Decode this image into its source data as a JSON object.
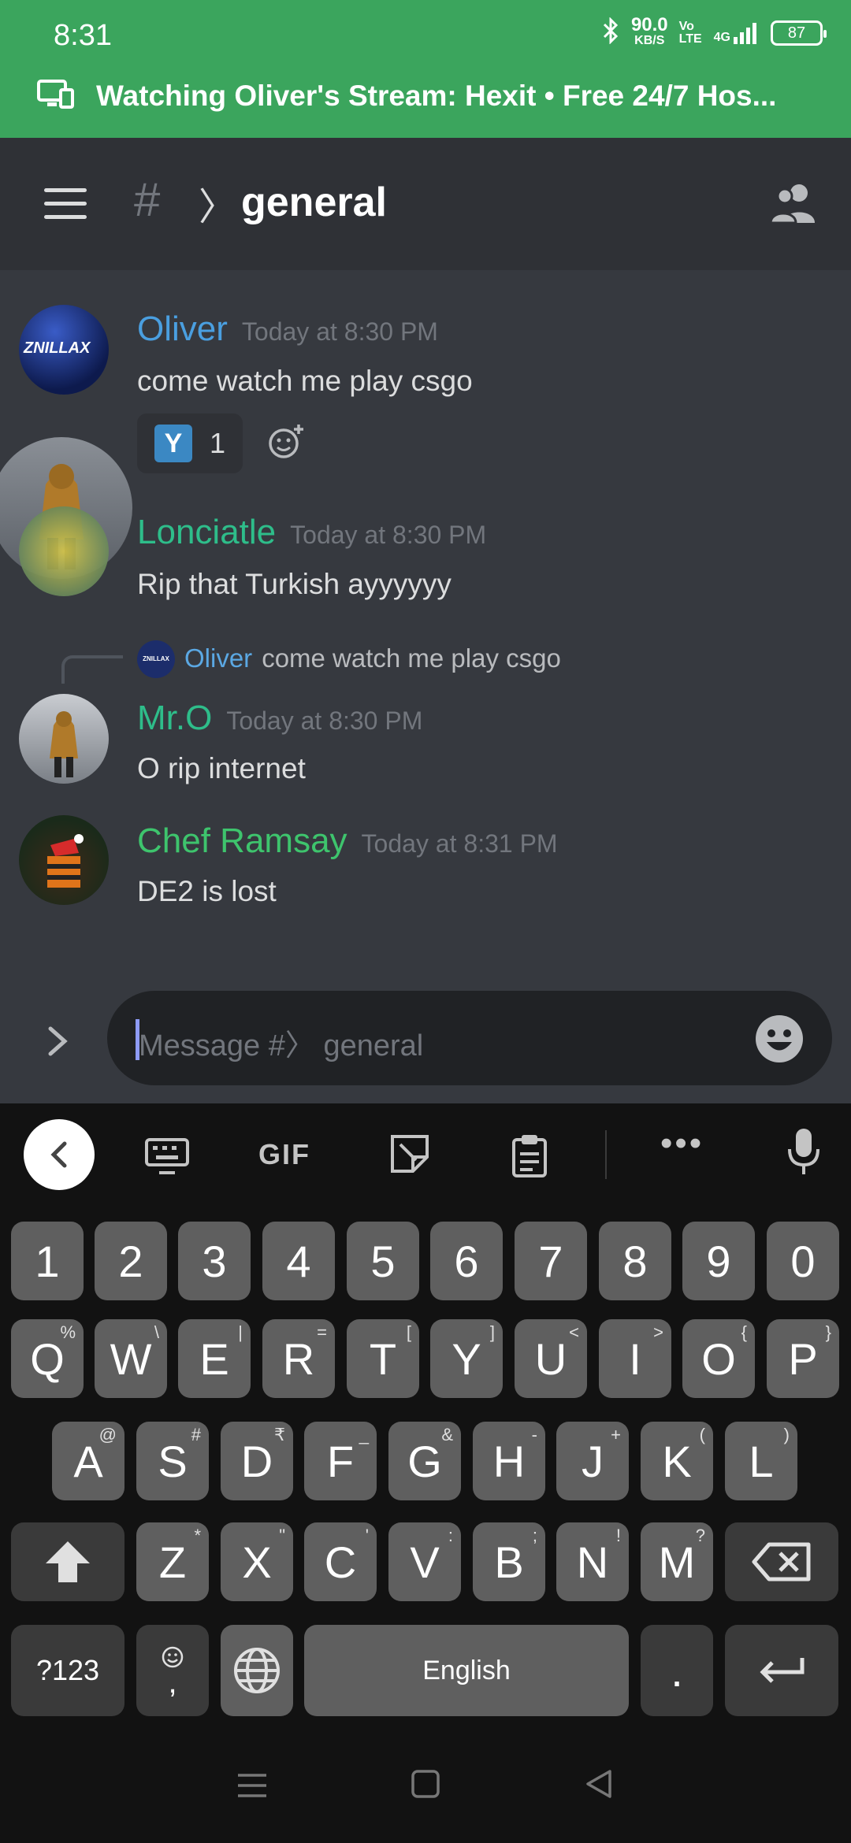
{
  "status_bar": {
    "time": "8:31",
    "speed_value": "90.0",
    "speed_unit": "KB/S",
    "volte": "Vo LTE",
    "network": "4G",
    "battery": "87"
  },
  "stream_banner": {
    "text": "Watching Oliver's Stream: Hexit • Free 24/7 Hos..."
  },
  "header": {
    "hash": "#",
    "chevron": "〉",
    "channel": "general"
  },
  "messages": [
    {
      "author": "Oliver",
      "author_color": "#4a9fe0",
      "time": "Today at 8:30 PM",
      "text": "come watch me play csgo",
      "avatar_label": "ZNILLAX"
    },
    {
      "author": "Lonciatle",
      "author_color": "#2ebd8a",
      "time": "Today at 8:30 PM",
      "text": "Rip that Turkish ayyyyyy"
    },
    {
      "author": "Mr.O",
      "author_color": "#2ebd8a",
      "time": "Today at 8:30 PM",
      "text": "O rip internet"
    },
    {
      "author": "Chef Ramsay",
      "author_color": "#3ec46d",
      "time": "Today at 8:31 PM",
      "text": "DE2 is lost"
    }
  ],
  "reaction": {
    "emoji": "Y",
    "count": "1"
  },
  "reply": {
    "avatar_label": "ZNILLAX",
    "author": "Oliver",
    "text": "come watch me play csgo"
  },
  "composer": {
    "placeholder": "Message #〉 general"
  },
  "keyboard": {
    "toolbar": {
      "gif": "GIF",
      "more": "•••"
    },
    "numbers": [
      "1",
      "2",
      "3",
      "4",
      "5",
      "6",
      "7",
      "8",
      "9",
      "0"
    ],
    "row1": [
      {
        "k": "Q",
        "h": "%"
      },
      {
        "k": "W",
        "h": "\\"
      },
      {
        "k": "E",
        "h": "|"
      },
      {
        "k": "R",
        "h": "="
      },
      {
        "k": "T",
        "h": "["
      },
      {
        "k": "Y",
        "h": "]"
      },
      {
        "k": "U",
        "h": "<"
      },
      {
        "k": "I",
        "h": ">"
      },
      {
        "k": "O",
        "h": "{"
      },
      {
        "k": "P",
        "h": "}"
      }
    ],
    "row2": [
      {
        "k": "A",
        "h": "@"
      },
      {
        "k": "S",
        "h": "#"
      },
      {
        "k": "D",
        "h": "₹"
      },
      {
        "k": "F",
        "h": "_"
      },
      {
        "k": "G",
        "h": "&"
      },
      {
        "k": "H",
        "h": "-"
      },
      {
        "k": "J",
        "h": "+"
      },
      {
        "k": "K",
        "h": "("
      },
      {
        "k": "L",
        "h": ")"
      }
    ],
    "row3": [
      {
        "k": "Z",
        "h": "*"
      },
      {
        "k": "X",
        "h": "\""
      },
      {
        "k": "C",
        "h": "'"
      },
      {
        "k": "V",
        "h": ":"
      },
      {
        "k": "B",
        "h": ";"
      },
      {
        "k": "N",
        "h": "!"
      },
      {
        "k": "M",
        "h": "?"
      }
    ],
    "symbols": "?123",
    "comma": ",",
    "space": "English",
    "period": "."
  }
}
